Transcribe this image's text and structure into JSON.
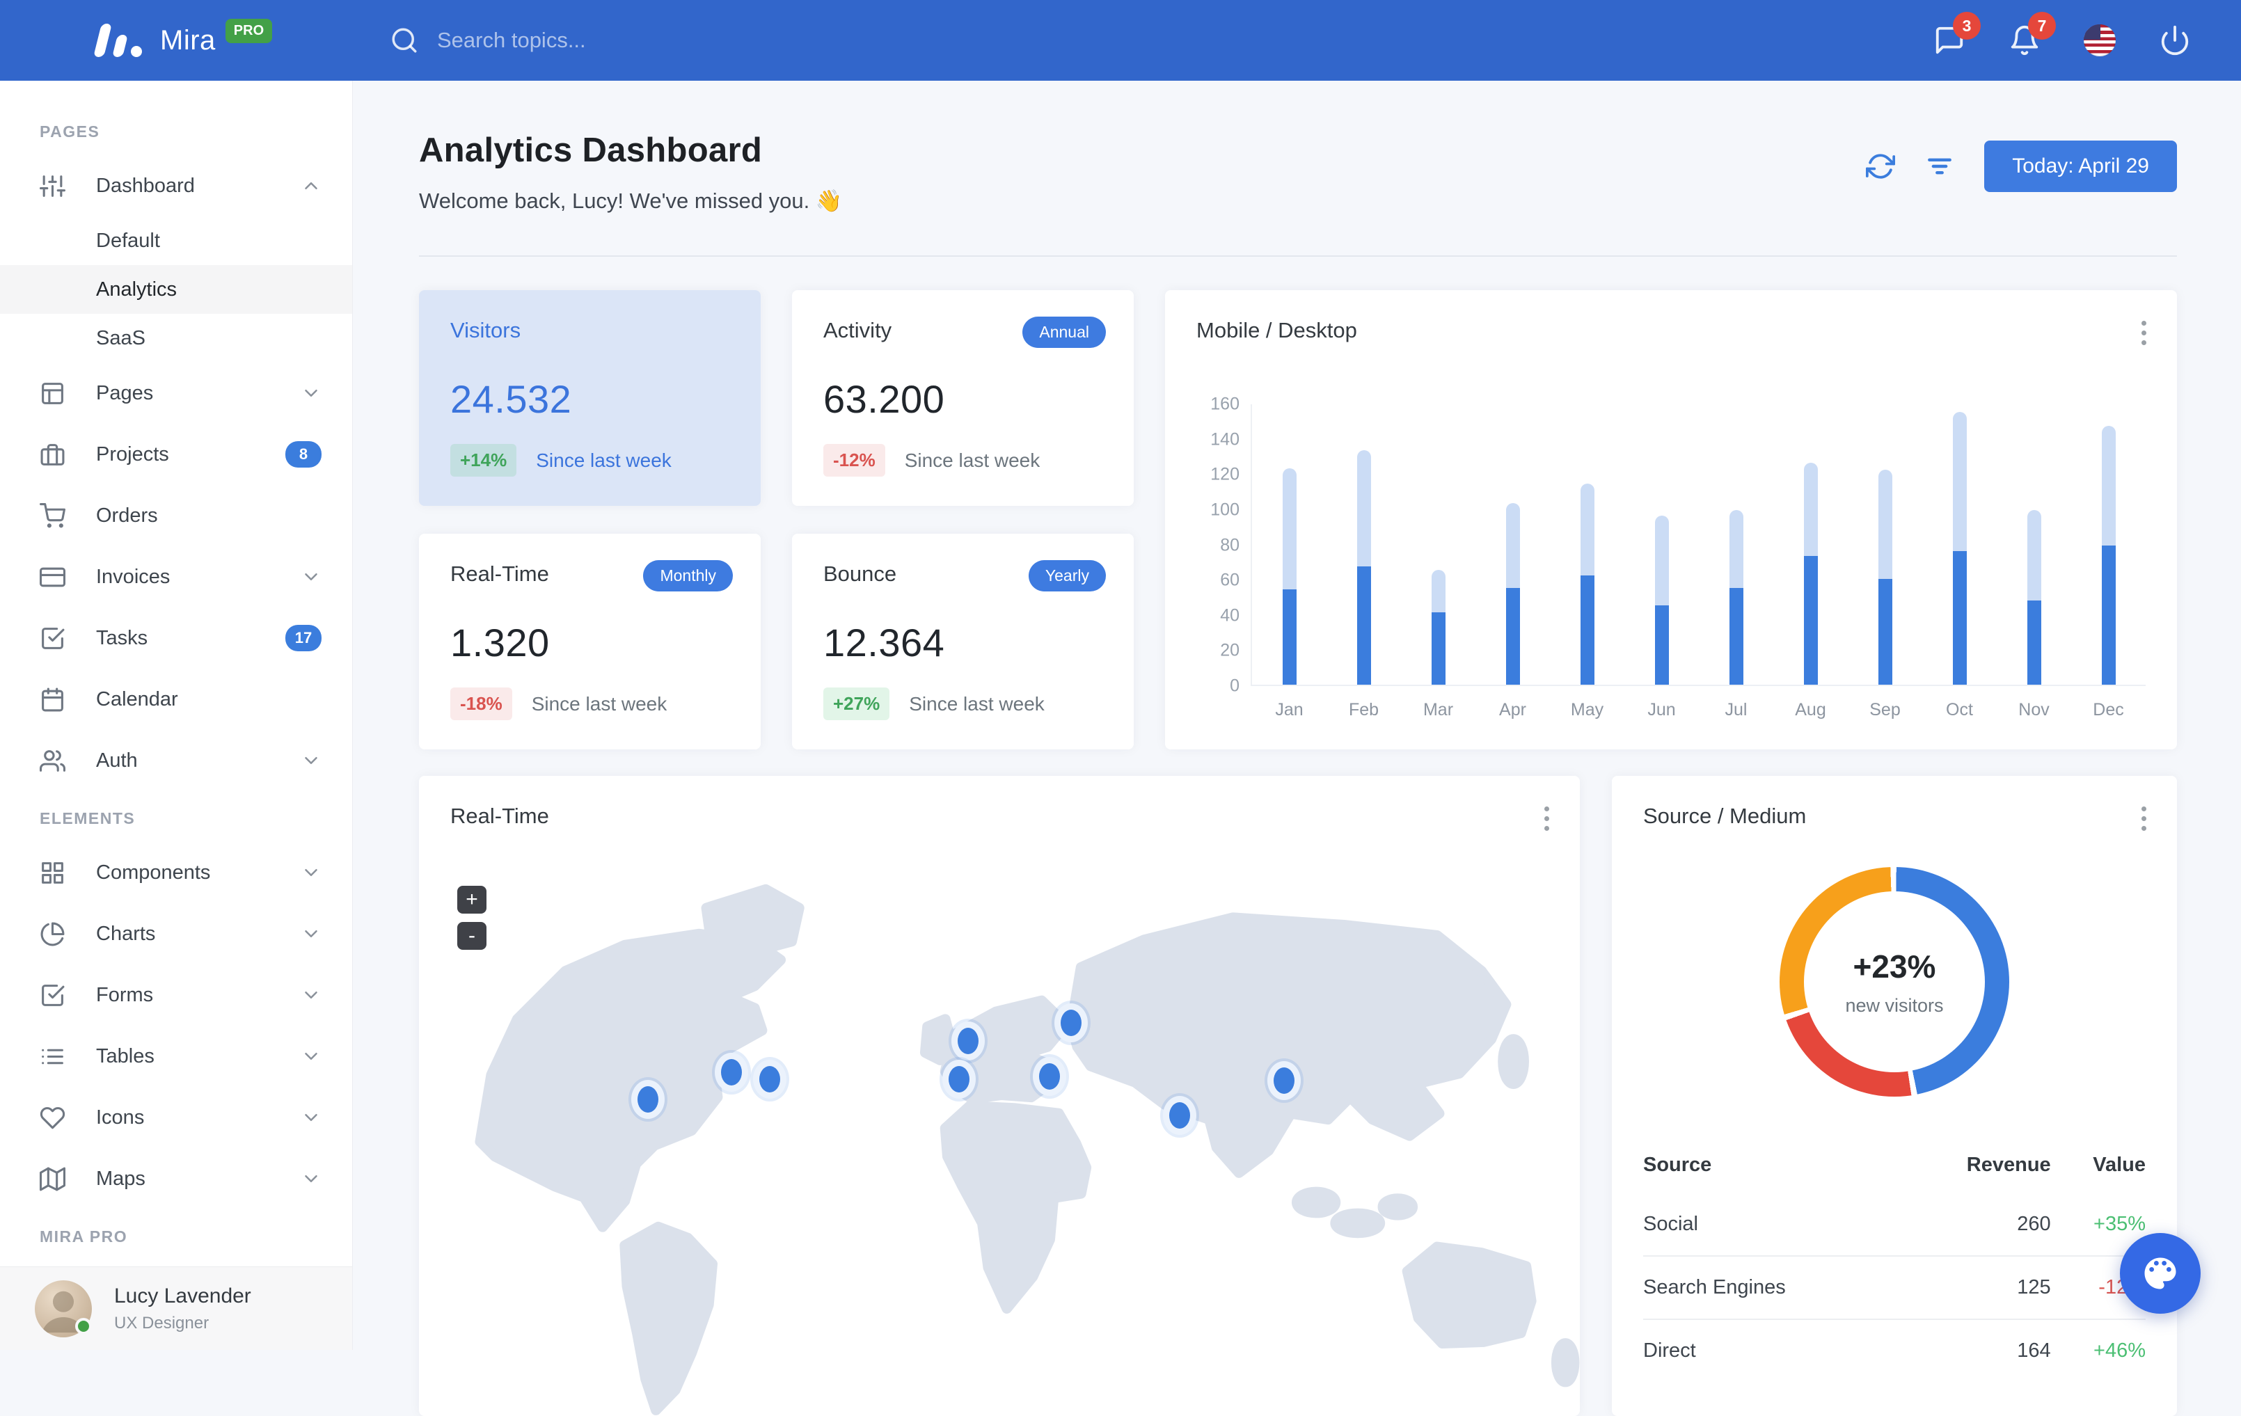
{
  "navbar": {
    "brand": "Mira",
    "brand_badge": "PRO",
    "search_placeholder": "Search topics...",
    "messages_badge": "3",
    "notifications_badge": "7"
  },
  "sidebar": {
    "sections": [
      {
        "header": "PAGES",
        "items": [
          {
            "id": "dashboard",
            "label": "Dashboard",
            "icon": "sliders",
            "chevron": "up"
          },
          {
            "id": "dashboard-default",
            "label": "Default",
            "sub": true
          },
          {
            "id": "dashboard-analytics",
            "label": "Analytics",
            "sub": true,
            "active": true
          },
          {
            "id": "dashboard-saas",
            "label": "SaaS",
            "sub": true
          },
          {
            "id": "pages",
            "label": "Pages",
            "icon": "layout",
            "chevron": "down"
          },
          {
            "id": "projects",
            "label": "Projects",
            "icon": "briefcase",
            "badge": "8"
          },
          {
            "id": "orders",
            "label": "Orders",
            "icon": "cart"
          },
          {
            "id": "invoices",
            "label": "Invoices",
            "icon": "credit-card",
            "chevron": "down"
          },
          {
            "id": "tasks",
            "label": "Tasks",
            "icon": "check-square",
            "badge": "17"
          },
          {
            "id": "calendar",
            "label": "Calendar",
            "icon": "calendar"
          },
          {
            "id": "auth",
            "label": "Auth",
            "icon": "users",
            "chevron": "down"
          }
        ]
      },
      {
        "header": "ELEMENTS",
        "items": [
          {
            "id": "components",
            "label": "Components",
            "icon": "grid",
            "chevron": "down"
          },
          {
            "id": "charts",
            "label": "Charts",
            "icon": "pie-chart",
            "chevron": "down"
          },
          {
            "id": "forms",
            "label": "Forms",
            "icon": "check-square",
            "chevron": "down"
          },
          {
            "id": "tables",
            "label": "Tables",
            "icon": "list",
            "chevron": "down"
          },
          {
            "id": "icons",
            "label": "Icons",
            "icon": "heart",
            "chevron": "down"
          },
          {
            "id": "maps",
            "label": "Maps",
            "icon": "map",
            "chevron": "down"
          }
        ]
      },
      {
        "header": "MIRA PRO",
        "items": []
      }
    ],
    "user": {
      "name": "Lucy Lavender",
      "role": "UX Designer"
    }
  },
  "header": {
    "title": "Analytics Dashboard",
    "subtitle": "Welcome back, Lucy! We've missed you. 👋",
    "date_button": "Today: April 29"
  },
  "stats": [
    {
      "title": "Visitors",
      "pill": "",
      "value": "24.532",
      "delta": "+14%",
      "dir": "up",
      "note": "Since last week"
    },
    {
      "title": "Activity",
      "pill": "Annual",
      "value": "63.200",
      "delta": "-12%",
      "dir": "down",
      "note": "Since last week"
    },
    {
      "title": "Real-Time",
      "pill": "Monthly",
      "value": "1.320",
      "delta": "-18%",
      "dir": "down",
      "note": "Since last week"
    },
    {
      "title": "Bounce",
      "pill": "Yearly",
      "value": "12.364",
      "delta": "+27%",
      "dir": "up",
      "note": "Since last week"
    }
  ],
  "chart_data": [
    {
      "type": "bar",
      "title": "Mobile / Desktop",
      "stacked": true,
      "categories": [
        "Jan",
        "Feb",
        "Mar",
        "Apr",
        "May",
        "Jun",
        "Jul",
        "Aug",
        "Sep",
        "Oct",
        "Nov",
        "Dec"
      ],
      "series": [
        {
          "name": "Mobile",
          "color": "#3B7DDD",
          "values": [
            54,
            67,
            41,
            55,
            62,
            45,
            55,
            73,
            60,
            76,
            48,
            79
          ]
        },
        {
          "name": "Desktop",
          "color": "#CBDCF5",
          "values": [
            69,
            66,
            24,
            48,
            52,
            51,
            44,
            53,
            62,
            79,
            51,
            68
          ]
        }
      ],
      "ylim": [
        0,
        160
      ],
      "ytick_step": 20,
      "grid": false,
      "legend": "none"
    },
    {
      "type": "pie",
      "title": "Source / Medium",
      "labels": [
        "Social",
        "Search Engines",
        "Direct"
      ],
      "values": [
        260,
        125,
        164
      ],
      "colors": [
        "#3B7DDD",
        "#E5473B",
        "#F7A01B"
      ],
      "center": {
        "value": "+23%",
        "label": "new visitors"
      },
      "table": {
        "headers": [
          "Source",
          "Revenue",
          "Value"
        ],
        "rows": [
          {
            "source": "Social",
            "revenue": "260",
            "value": "+35%",
            "dir": "up"
          },
          {
            "source": "Search Engines",
            "revenue": "125",
            "value": "-12%",
            "dir": "down"
          },
          {
            "source": "Direct",
            "revenue": "164",
            "value": "+46%",
            "dir": "up"
          }
        ]
      }
    }
  ],
  "map": {
    "title": "Real-Time",
    "zoom_in": "+",
    "zoom_out": "-",
    "markers": [
      {
        "name": "san-francisco",
        "x": 19.7,
        "y": 43.8
      },
      {
        "name": "chicago",
        "x": 26.9,
        "y": 39.0
      },
      {
        "name": "new-york",
        "x": 30.2,
        "y": 40.3
      },
      {
        "name": "london",
        "x": 47.3,
        "y": 33.4
      },
      {
        "name": "madrid",
        "x": 46.5,
        "y": 40.3
      },
      {
        "name": "moscow",
        "x": 56.2,
        "y": 30.3
      },
      {
        "name": "istanbul",
        "x": 54.3,
        "y": 39.7
      },
      {
        "name": "delhi",
        "x": 65.5,
        "y": 46.7
      },
      {
        "name": "beijing",
        "x": 74.5,
        "y": 40.5
      }
    ]
  },
  "colors": {
    "navbar": "#3266CB",
    "primary": "#3B7DDD",
    "button": "#3E7BE0",
    "success": "#4BBF73",
    "danger": "#D9534F",
    "warning": "#F7A01B",
    "highlight_card": "#DBE5F7",
    "badge_red": "#E5473B",
    "pro_badge": "#43A047"
  }
}
